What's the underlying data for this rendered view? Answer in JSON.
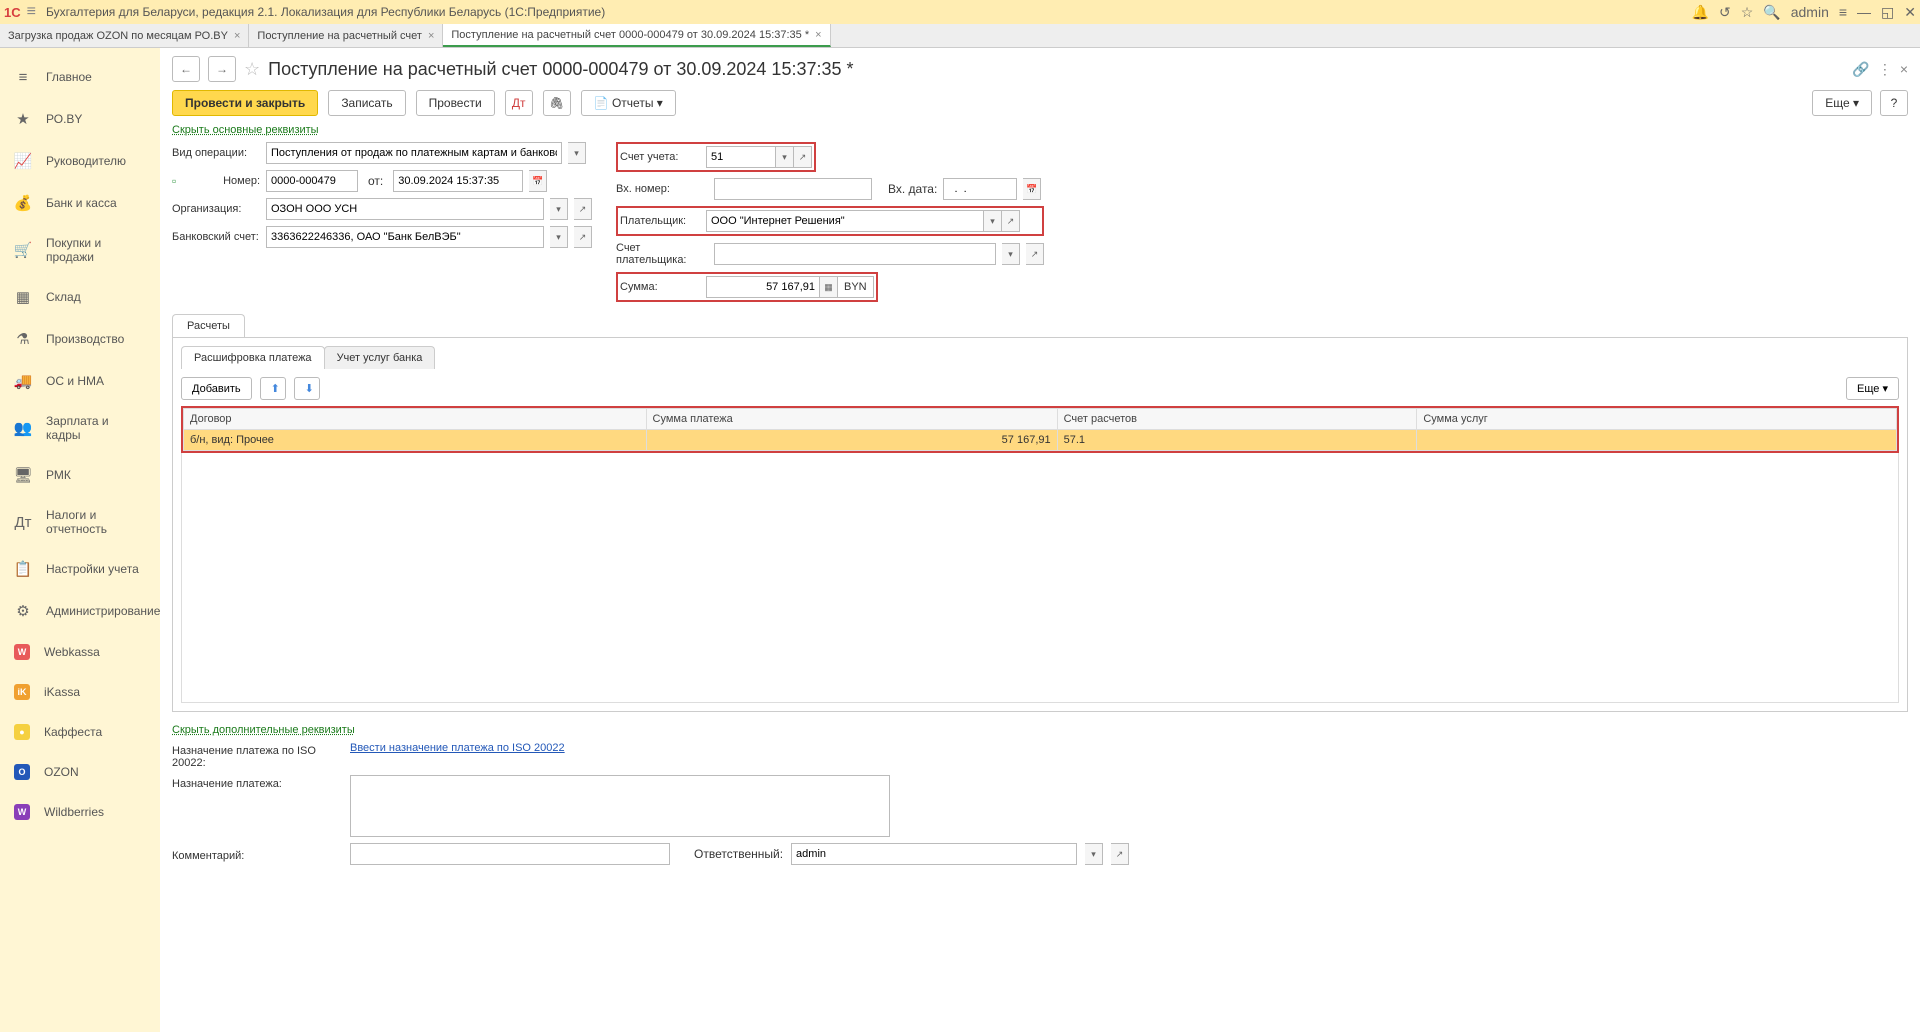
{
  "titlebar": {
    "logo": "1С",
    "title": "Бухгалтерия для Беларуси, редакция 2.1. Локализация для Республики Беларусь  (1С:Предприятие)",
    "user": "admin"
  },
  "tabs": [
    {
      "label": "Загрузка продаж OZON по месяцам РО.BY"
    },
    {
      "label": "Поступление на расчетный счет"
    },
    {
      "label": "Поступление на расчетный счет 0000-000479 от 30.09.2024 15:37:35 *",
      "active": true
    }
  ],
  "sidebar": [
    {
      "label": "Главное",
      "icon": "≡"
    },
    {
      "label": "РО.BY",
      "icon": "★"
    },
    {
      "label": "Руководителю",
      "icon": "📈"
    },
    {
      "label": "Банк и касса",
      "icon": "💰"
    },
    {
      "label": "Покупки и продажи",
      "icon": "🛒"
    },
    {
      "label": "Склад",
      "icon": "▦"
    },
    {
      "label": "Производство",
      "icon": "⚗"
    },
    {
      "label": "ОС и НМА",
      "icon": "🚚"
    },
    {
      "label": "Зарплата и кадры",
      "icon": "👥"
    },
    {
      "label": "РМК",
      "icon": "🖥"
    },
    {
      "label": "Налоги и отчетность",
      "icon": "Дт"
    },
    {
      "label": "Настройки учета",
      "icon": "📋"
    },
    {
      "label": "Администрирование",
      "icon": "⚙"
    },
    {
      "label": "Webkassa",
      "icon": "W",
      "bg": "#e85a5a"
    },
    {
      "label": "iKassa",
      "icon": "iK",
      "bg": "#f0a030"
    },
    {
      "label": "Каффеста",
      "icon": "●",
      "bg": "#f5d040"
    },
    {
      "label": "OZON",
      "icon": "O",
      "bg": "#2358b8"
    },
    {
      "label": "Wildberries",
      "icon": "W",
      "bg": "#8a3fb8"
    }
  ],
  "page": {
    "title": "Поступление на расчетный счет 0000-000479 от 30.09.2024 15:37:35 *"
  },
  "toolbar": {
    "post_close": "Провести и закрыть",
    "write": "Записать",
    "post": "Провести",
    "reports": "Отчеты",
    "more": "Еще"
  },
  "form": {
    "hide_req": "Скрыть основные реквизиты",
    "op_type_label": "Вид операции:",
    "op_type": "Поступления от продаж по платежным картам и банковским кредитам",
    "number_label": "Номер:",
    "number": "0000-000479",
    "date_label": "от:",
    "date": "30.09.2024 15:37:35",
    "org_label": "Организация:",
    "org": "ОЗОН ООО УСН",
    "bank_acc_label": "Банковский счет:",
    "bank_acc": "3363622246336, ОАО \"Банк БелВЭБ\"",
    "account_label": "Счет учета:",
    "account": "51",
    "in_num_label": "Вх. номер:",
    "in_num": "",
    "in_date_label": "Вх. дата:",
    "in_date": "  .  .",
    "payer_label": "Плательщик:",
    "payer": "ООО \"Интернет Решения\"",
    "payer_acc_label": "Счет плательщика:",
    "payer_acc": "",
    "sum_label": "Сумма:",
    "sum": "57 167,91",
    "currency": "BYN"
  },
  "section": {
    "tab": "Расчеты",
    "inner_tabs": [
      "Расшифровка платежа",
      "Учет услуг банка"
    ],
    "add": "Добавить",
    "more": "Еще",
    "columns": [
      "Договор",
      "Сумма платежа",
      "Счет расчетов",
      "Сумма услуг"
    ],
    "row": {
      "contract": "б/н, вид: Прочее",
      "amount": "57 167,91",
      "account": "57.1",
      "service": ""
    }
  },
  "bottom": {
    "hide_add": "Скрыть дополнительные реквизиты",
    "iso_label": "Назначение платежа по ISO 20022:",
    "iso_link": "Ввести назначение платежа по ISO 20022",
    "purpose_label": "Назначение платежа:",
    "comment_label": "Комментарий:",
    "resp_label": "Ответственный:",
    "resp": "admin"
  }
}
